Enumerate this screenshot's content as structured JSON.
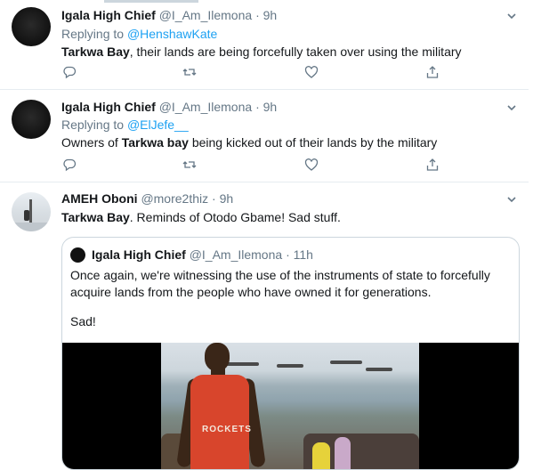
{
  "tweets": [
    {
      "name": "Igala High Chief",
      "handle": "@I_Am_Ilemona",
      "separator": "·",
      "time": "9h",
      "reply_prefix": "Replying to",
      "reply_to": "@HenshawKate",
      "body_bold": "Tarkwa Bay",
      "body_rest": ", their lands are being forcefully taken over using the military"
    },
    {
      "name": "Igala High Chief",
      "handle": "@I_Am_Ilemona",
      "separator": "·",
      "time": "9h",
      "reply_prefix": "Replying to",
      "reply_to": "@ElJefe__",
      "body_pre": "Owners of ",
      "body_bold": "Tarkwa bay",
      "body_rest": " being kicked out of their lands by the military"
    },
    {
      "name": "AMEH Oboni",
      "handle": "@more2thiz",
      "separator": "·",
      "time": "9h",
      "body_bold": "Tarkwa Bay",
      "body_rest": ". Reminds of Otodo Gbame! Sad stuff.",
      "quoted": {
        "name": "Igala High Chief",
        "handle": "@I_Am_Ilemona",
        "separator": "·",
        "time": "11h",
        "text_line1": "Once again, we're witnessing the use of the instruments of state to forcefully",
        "text_line2": "acquire lands from the people who have owned it for generations.",
        "text_line3": "Sad!",
        "media_caption": "ROCKETS"
      }
    }
  ],
  "icons": {
    "reply": "reply-icon",
    "retweet": "retweet-icon",
    "like": "heart-icon",
    "share": "share-icon",
    "menu": "chevron-down-icon"
  },
  "colors": {
    "link": "#1da1f2",
    "secondary": "#657786",
    "divider": "#e6ecf0"
  }
}
